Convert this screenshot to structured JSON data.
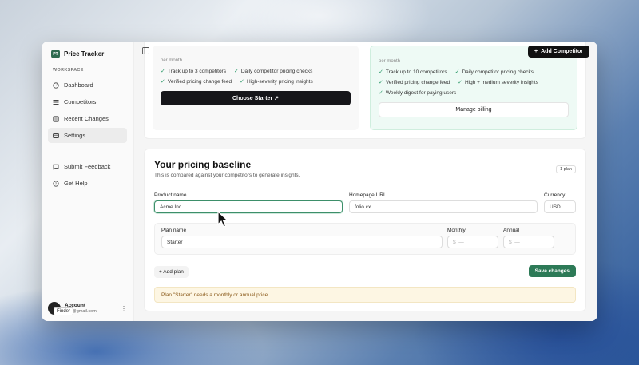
{
  "app": {
    "name": "Price Tracker",
    "logo_text": "PT"
  },
  "sidebar": {
    "section_label": "WORKSPACE",
    "items": [
      {
        "label": "Dashboard",
        "icon": "dashboard-icon"
      },
      {
        "label": "Competitors",
        "icon": "competitors-icon"
      },
      {
        "label": "Recent Changes",
        "icon": "changes-icon"
      },
      {
        "label": "Settings",
        "icon": "settings-icon",
        "active": true
      }
    ],
    "secondary": [
      {
        "label": "Submit Feedback",
        "icon": "feedback-icon"
      },
      {
        "label": "Get Help",
        "icon": "help-icon"
      }
    ],
    "account": {
      "name": "Account",
      "email": "341@gmail.com"
    },
    "tooltip": "Finder"
  },
  "topbar": {
    "add_competitor": "Add Competitor"
  },
  "plans": {
    "starter": {
      "period": "per month",
      "features": [
        "Track up to 3 competitors",
        "Daily competitor pricing checks",
        "Verified pricing change feed",
        "High-severity pricing insights"
      ],
      "cta": "Choose Starter"
    },
    "pro": {
      "period": "per month",
      "features": [
        "Track up to 10 competitors",
        "Daily competitor pricing checks",
        "Verified pricing change feed",
        "High + medium severity insights",
        "Weekly digest for paying users"
      ],
      "cta": "Manage billing"
    }
  },
  "baseline": {
    "title": "Your pricing baseline",
    "subtitle": "This is compared against your competitors to generate insights.",
    "badge": "1 plan",
    "product_label": "Product name",
    "product_value": "Acme Inc",
    "url_label": "Homepage URL",
    "url_value": "folio.cx",
    "currency_label": "Currency",
    "currency_value": "USD",
    "plan_name_label": "Plan name",
    "plan_name_value": "Starter",
    "monthly_label": "Monthly",
    "monthly_prefix": "$",
    "monthly_placeholder": "—",
    "annual_label": "Annual",
    "annual_prefix": "$",
    "annual_placeholder": "—",
    "add_plan": "+ Add plan",
    "save": "Save changes",
    "warning": "Plan \"Starter\" needs a monthly or annual price."
  },
  "colors": {
    "accent": "#2d7a57",
    "dark": "#111111",
    "warning_bg": "#fdf6e3"
  }
}
